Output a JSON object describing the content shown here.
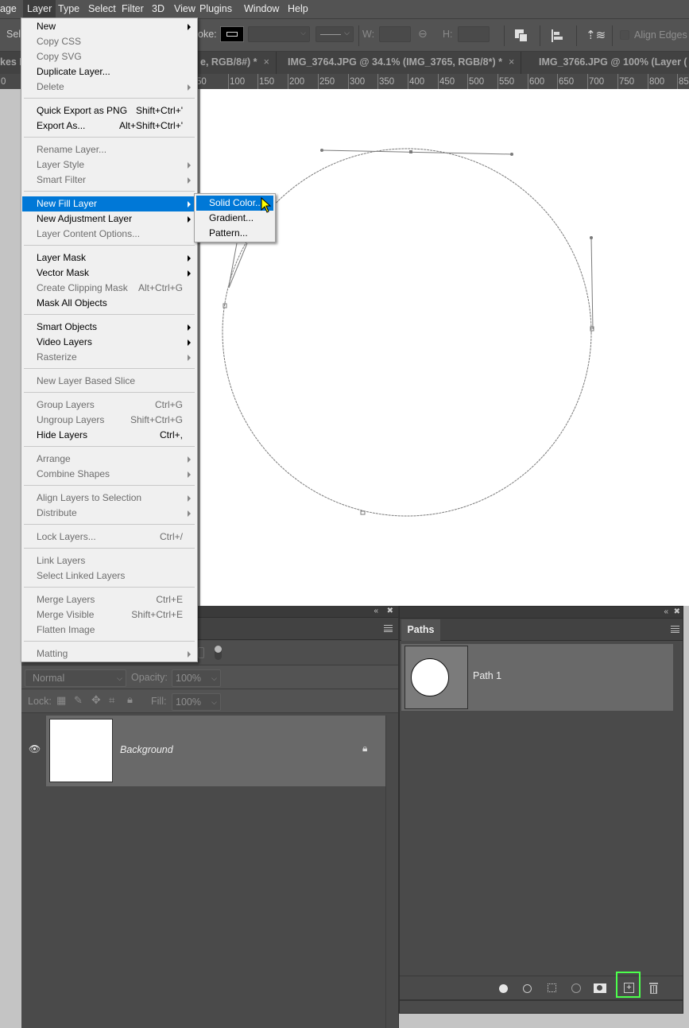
{
  "menubar": {
    "items": [
      "age",
      "Layer",
      "Type",
      "Select",
      "Filter",
      "3D",
      "View",
      "Plugins",
      "Window",
      "Help"
    ],
    "active": "Layer"
  },
  "options_bar": {
    "tool_label_partial": "Sel",
    "stroke_label_partial": "oke:",
    "width_label": "W:",
    "height_label": "H:",
    "align_edges_label": "Align Edges",
    "align_edges_checked": false
  },
  "tabs": [
    {
      "label": "kes I",
      "close": ""
    },
    {
      "label": "e, RGB/8#) *",
      "close": "×"
    },
    {
      "label": "IMG_3764.JPG @ 34.1% (IMG_3765, RGB/8*) *",
      "close": "×"
    },
    {
      "label": "IMG_3766.JPG @ 100% (Layer (",
      "close": ""
    }
  ],
  "ruler": {
    "ticks": [
      "0",
      "50",
      "100",
      "150",
      "200",
      "250",
      "300",
      "350",
      "400",
      "450",
      "500",
      "550",
      "600",
      "650",
      "700",
      "750",
      "800",
      "85"
    ]
  },
  "layer_menu": {
    "items": [
      {
        "label": "New",
        "shortcut": "",
        "submenu": true,
        "disabled": false
      },
      {
        "label": "Copy CSS",
        "shortcut": "",
        "submenu": false,
        "disabled": true
      },
      {
        "label": "Copy SVG",
        "shortcut": "",
        "submenu": false,
        "disabled": true
      },
      {
        "label": "Duplicate Layer...",
        "shortcut": "",
        "submenu": false,
        "disabled": false
      },
      {
        "label": "Delete",
        "shortcut": "",
        "submenu": true,
        "disabled": true
      },
      {
        "sep": true
      },
      {
        "label": "Quick Export as PNG",
        "shortcut": "Shift+Ctrl+'",
        "submenu": false,
        "disabled": false
      },
      {
        "label": "Export As...",
        "shortcut": "Alt+Shift+Ctrl+'",
        "submenu": false,
        "disabled": false
      },
      {
        "sep": true
      },
      {
        "label": "Rename Layer...",
        "shortcut": "",
        "submenu": false,
        "disabled": true
      },
      {
        "label": "Layer Style",
        "shortcut": "",
        "submenu": true,
        "disabled": true
      },
      {
        "label": "Smart Filter",
        "shortcut": "",
        "submenu": true,
        "disabled": true
      },
      {
        "sep": true
      },
      {
        "label": "New Fill Layer",
        "shortcut": "",
        "submenu": true,
        "disabled": false,
        "highlighted": true
      },
      {
        "label": "New Adjustment Layer",
        "shortcut": "",
        "submenu": true,
        "disabled": false
      },
      {
        "label": "Layer Content Options...",
        "shortcut": "",
        "submenu": false,
        "disabled": true
      },
      {
        "sep": true
      },
      {
        "label": "Layer Mask",
        "shortcut": "",
        "submenu": true,
        "disabled": false
      },
      {
        "label": "Vector Mask",
        "shortcut": "",
        "submenu": true,
        "disabled": false
      },
      {
        "label": "Create Clipping Mask",
        "shortcut": "Alt+Ctrl+G",
        "submenu": false,
        "disabled": true
      },
      {
        "label": "Mask All Objects",
        "shortcut": "",
        "submenu": false,
        "disabled": false
      },
      {
        "sep": true
      },
      {
        "label": "Smart Objects",
        "shortcut": "",
        "submenu": true,
        "disabled": false
      },
      {
        "label": "Video Layers",
        "shortcut": "",
        "submenu": true,
        "disabled": false
      },
      {
        "label": "Rasterize",
        "shortcut": "",
        "submenu": true,
        "disabled": true
      },
      {
        "sep": true
      },
      {
        "label": "New Layer Based Slice",
        "shortcut": "",
        "submenu": false,
        "disabled": true
      },
      {
        "sep": true
      },
      {
        "label": "Group Layers",
        "shortcut": "Ctrl+G",
        "submenu": false,
        "disabled": true
      },
      {
        "label": "Ungroup Layers",
        "shortcut": "Shift+Ctrl+G",
        "submenu": false,
        "disabled": true
      },
      {
        "label": "Hide Layers",
        "shortcut": "Ctrl+,",
        "submenu": false,
        "disabled": false
      },
      {
        "sep": true
      },
      {
        "label": "Arrange",
        "shortcut": "",
        "submenu": true,
        "disabled": true
      },
      {
        "label": "Combine Shapes",
        "shortcut": "",
        "submenu": true,
        "disabled": true
      },
      {
        "sep": true
      },
      {
        "label": "Align Layers to Selection",
        "shortcut": "",
        "submenu": true,
        "disabled": true
      },
      {
        "label": "Distribute",
        "shortcut": "",
        "submenu": true,
        "disabled": true
      },
      {
        "sep": true
      },
      {
        "label": "Lock Layers...",
        "shortcut": "Ctrl+/",
        "submenu": false,
        "disabled": true
      },
      {
        "sep": true
      },
      {
        "label": "Link Layers",
        "shortcut": "",
        "submenu": false,
        "disabled": true
      },
      {
        "label": "Select Linked Layers",
        "shortcut": "",
        "submenu": false,
        "disabled": true
      },
      {
        "sep": true
      },
      {
        "label": "Merge Layers",
        "shortcut": "Ctrl+E",
        "submenu": false,
        "disabled": true
      },
      {
        "label": "Merge Visible",
        "shortcut": "Shift+Ctrl+E",
        "submenu": false,
        "disabled": true
      },
      {
        "label": "Flatten Image",
        "shortcut": "",
        "submenu": false,
        "disabled": true
      },
      {
        "sep": true
      },
      {
        "label": "Matting",
        "shortcut": "",
        "submenu": true,
        "disabled": true
      }
    ]
  },
  "fill_submenu": {
    "items": [
      {
        "label": "Solid Color...",
        "highlighted": true
      },
      {
        "label": "Gradient...",
        "highlighted": false
      },
      {
        "label": "Pattern...",
        "highlighted": false
      }
    ]
  },
  "layers_panel": {
    "blend_mode": "Normal",
    "opacity_label": "Opacity:",
    "opacity_value": "100%",
    "lock_label": "Lock:",
    "fill_label": "Fill:",
    "fill_value": "100%",
    "layers": [
      {
        "name": "Background",
        "visible": true,
        "locked": true
      }
    ]
  },
  "paths_panel": {
    "tab_label": "Paths",
    "paths": [
      {
        "name": "Path 1"
      }
    ],
    "footer_buttons": [
      "fill-path",
      "stroke-path",
      "load-as-selection",
      "make-work-path",
      "add-mask",
      "create-new-path",
      "delete-path"
    ],
    "highlighted_button": "create-new-path",
    "highlight_color": "#4cff4c"
  },
  "colors": {
    "menu_highlight": "#0078d7",
    "panel_bg": "#4a4a4a",
    "app_bg": "#535353"
  }
}
